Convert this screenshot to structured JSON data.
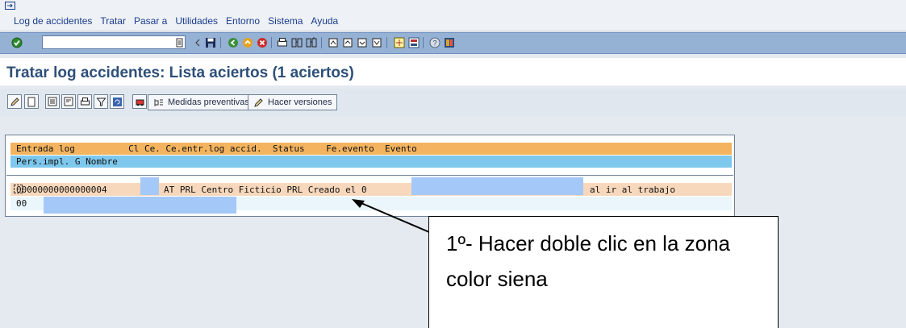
{
  "menu": {
    "items": [
      "Log de accidentes",
      "Tratar",
      "Pasar a",
      "Utilidades",
      "Entorno",
      "Sistema",
      "Ayuda"
    ]
  },
  "page_title": "Tratar log accidentes: Lista aciertos (1 aciertos)",
  "app_toolbar": {
    "preventive_label": "Medidas preventivas",
    "versions_label": "Hacer versiones"
  },
  "list": {
    "header_line1": "Entrada log          Cl Ce. Ce.entr.log accid.  Status    Fe.evento  Evento",
    "header_line2": "Pers.impl. G Nombre",
    "row1_left": "00000000000000004",
    "row1_middle": "AT PRL Centro Ficticio PRL Creado el 0",
    "row1_right": "al ir al trabajo",
    "row2_left": "00"
  },
  "callout": {
    "text": "1º- Hacer doble clic en la zona color siena"
  },
  "colors": {
    "header_orange": "#f4b45f",
    "header_blue": "#7ec8ed",
    "row_siena": "#f8d8bc",
    "title_blue": "#2d4f79"
  }
}
